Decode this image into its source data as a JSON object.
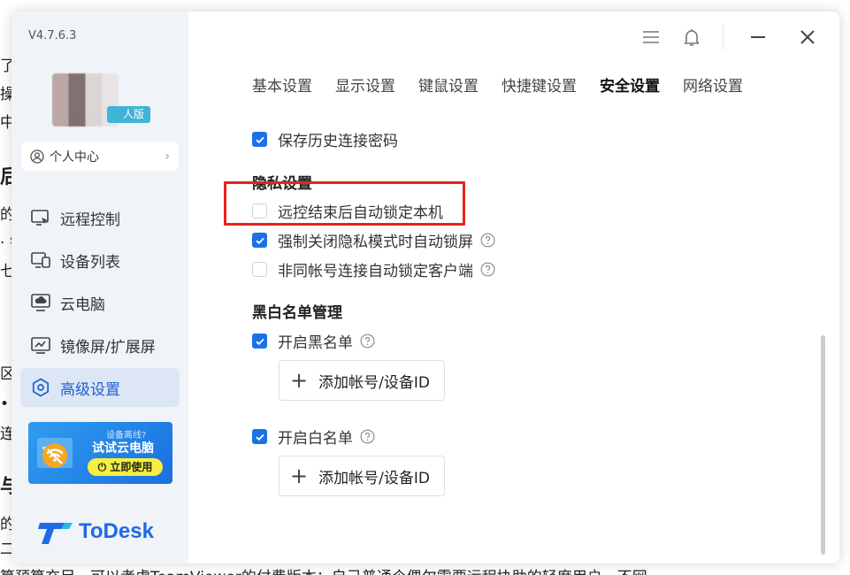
{
  "version": "V4.7.6.3",
  "edition_badge": "人版",
  "personal_center": "个人中心",
  "nav": [
    {
      "label": "远程控制",
      "icon": "remote-control-icon"
    },
    {
      "label": "设备列表",
      "icon": "device-list-icon"
    },
    {
      "label": "云电脑",
      "icon": "cloud-pc-icon"
    },
    {
      "label": "镜像屏/扩展屏",
      "icon": "mirror-screen-icon"
    },
    {
      "label": "高级设置",
      "icon": "advanced-settings-icon",
      "active": true
    }
  ],
  "promo": {
    "line1": "设备离线?",
    "line2": "试试云电脑",
    "button": "立即使用"
  },
  "logo_text": "ToDesk",
  "tabs": [
    {
      "label": "基本设置"
    },
    {
      "label": "显示设置"
    },
    {
      "label": "键鼠设置"
    },
    {
      "label": "快捷键设置"
    },
    {
      "label": "安全设置",
      "active": true
    },
    {
      "label": "网络设置"
    }
  ],
  "settings": {
    "save_history_password": {
      "label": "保存历史连接密码",
      "checked": true
    },
    "privacy_title": "隐私设置",
    "auto_lock_after_remote": {
      "label": "远控结束后自动锁定本机",
      "checked": false
    },
    "lock_on_privacy_close": {
      "label": "强制关闭隐私模式时自动锁屏",
      "checked": true
    },
    "lock_non_same_account": {
      "label": "非同帐号连接自动锁定客户端",
      "checked": false
    },
    "list_title": "黑白名单管理",
    "enable_blacklist": {
      "label": "开启黑名单",
      "checked": true
    },
    "add_blacklist": "添加帐号/设备ID",
    "enable_whitelist": {
      "label": "开启白名单",
      "checked": true
    },
    "add_whitelist": "添加帐号/设备ID"
  },
  "background_text": {
    "f1": "了",
    "f2": "操价",
    "f3": "中打",
    "f4": "后",
    "f5": "的安",
    "f6": "· 钅",
    "f7": "七足",
    "f8": "区力",
    "f9": "• 阼",
    "f10": "连拍",
    "f11": "与",
    "f12": "的法",
    "f13": "二令",
    "f14": "算预算充足，可以考虑TeamViewer的付费版本；自己普通个偶尔需要远程协助的轻度用户，不网"
  },
  "colors": {
    "accent": "#1b72e8",
    "highlight": "#e8231b",
    "sidebar_bg": "#f0f3f8"
  }
}
